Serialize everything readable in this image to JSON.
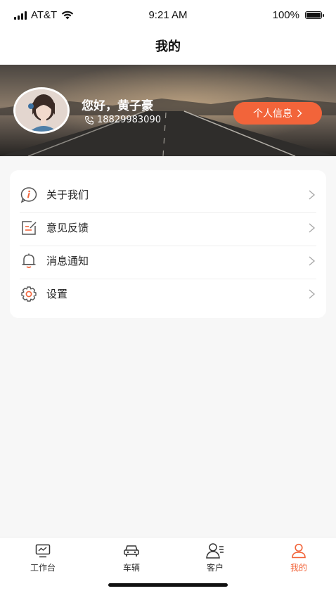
{
  "status_bar": {
    "carrier": "AT&T",
    "time": "9:21 AM",
    "battery": "100%"
  },
  "nav": {
    "title": "我的"
  },
  "profile": {
    "greeting": "您好，黄子豪",
    "phone": "18829983090",
    "info_button": "个人信息"
  },
  "menu": {
    "items": [
      {
        "label": "关于我们",
        "icon": "info-icon"
      },
      {
        "label": "意见反馈",
        "icon": "feedback-icon"
      },
      {
        "label": "消息通知",
        "icon": "bell-icon"
      },
      {
        "label": "设置",
        "icon": "gear-icon"
      }
    ]
  },
  "tabbar": {
    "tabs": [
      {
        "label": "工作台",
        "icon": "monitor-icon",
        "active": false
      },
      {
        "label": "车辆",
        "icon": "car-icon",
        "active": false
      },
      {
        "label": "客户",
        "icon": "customer-icon",
        "active": false
      },
      {
        "label": "我的",
        "icon": "person-icon",
        "active": true
      }
    ]
  },
  "colors": {
    "accent": "#f2643a",
    "icon_gray": "#555555"
  }
}
